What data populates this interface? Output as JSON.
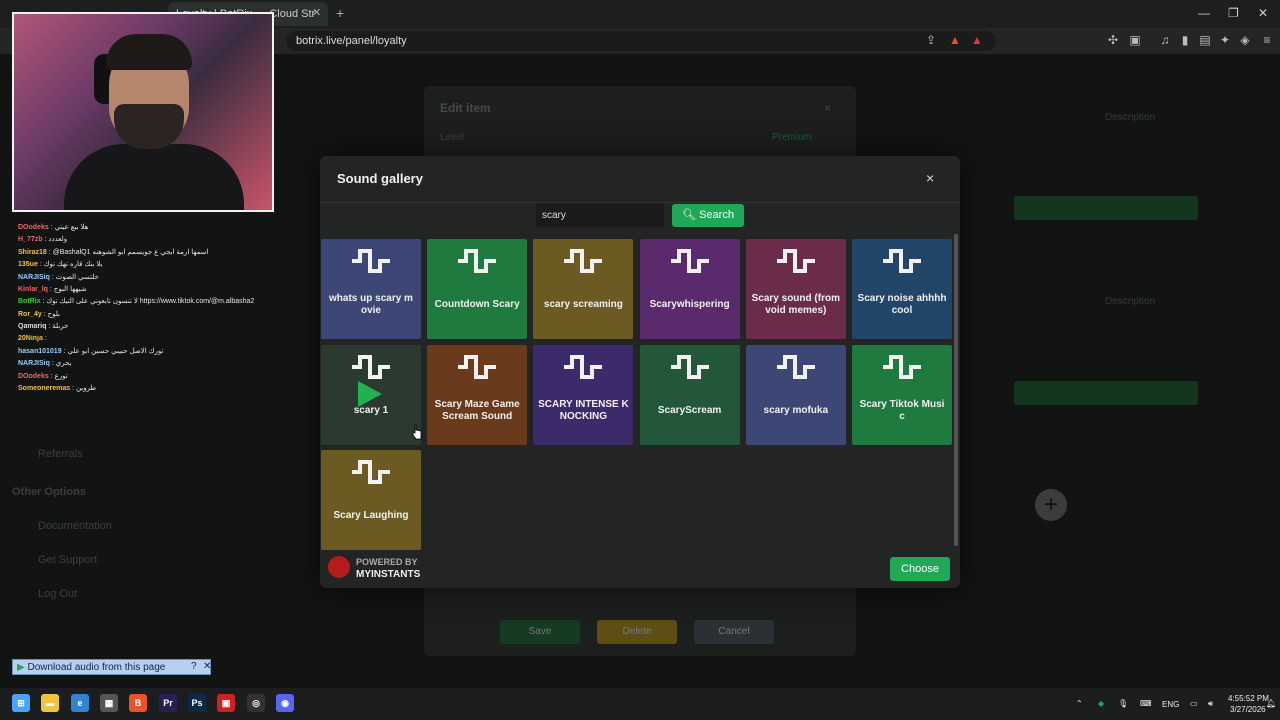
{
  "browser": {
    "tab_title": "Loyalty | BotRix — Cloud Str",
    "tab_close": "✕",
    "tab_new": "+",
    "url": "botrix.live/panel/loyalty",
    "win_minimize": "—",
    "win_restore": "❐",
    "win_close": "✕"
  },
  "background_page": {
    "edit_item_title": "Edit item",
    "level_label": "Level",
    "premium_label": "Premium",
    "description_label": "Description",
    "save_label": "Save",
    "delete_label": "Delete",
    "cancel_label": "Cancel",
    "menu_items": [
      "Referrals",
      "Other Options",
      "Documentation",
      "Get Support",
      "Log Out"
    ]
  },
  "chat": {
    "lines": [
      {
        "user": "DOodeks",
        "text": ": هلا بيع عيني",
        "color": "#e66"
      },
      {
        "user": "H_77zb",
        "text": ": ولعددد",
        "color": "#e66"
      },
      {
        "user": "Shiraz18",
        "text": ": @BashalQ1 اسمها ارمة ابجي ع جويسمم ابو الشوهنه",
        "color": "#f0c040"
      },
      {
        "user": "135ue",
        "text": ": يلا بنك قاره تهك توك",
        "color": "#f0c040"
      },
      {
        "user": "NARJISiq",
        "text": ": خلتسي الصوت",
        "color": "#9cf"
      },
      {
        "user": "Kinlar_lq",
        "text": ": شيهها البوج",
        "color": "#e66"
      },
      {
        "user": "BotRix",
        "text": ": لا تنسون تابعوني على التيك توك https://www.tiktok.com/@m.albasha2",
        "color": "#3c3"
      },
      {
        "user": "Ror_4y",
        "text": ": بلوح",
        "color": "#f0c040"
      },
      {
        "user": "Qamariq",
        "text": ": خربلة",
        "color": "#ddd"
      },
      {
        "user": "20Ninja",
        "text": ":",
        "color": "#f0c040"
      },
      {
        "user": "hasan101019",
        "text": ": تورك الاصل حبيبي حسين ابو علي",
        "color": "#9cf"
      },
      {
        "user": "NARJISiq",
        "text": ": بحري",
        "color": "#9cf"
      },
      {
        "user": "DOodeks",
        "text": ": تورع",
        "color": "#e66"
      },
      {
        "user": "Someoneremas",
        "text": ": طروين",
        "color": "#f0c040"
      }
    ]
  },
  "download_bar": {
    "label": "Download audio from this page"
  },
  "modal": {
    "title": "Sound gallery",
    "close": "×",
    "search": {
      "value": "scary",
      "button_label": "Search"
    },
    "sounds": [
      {
        "label": "whats up scary m ovie",
        "color": "#3d4776"
      },
      {
        "label": "Countdown Scary",
        "color": "#1e7a3e"
      },
      {
        "label": "scary screaming",
        "color": "#6b5a22"
      },
      {
        "label": "Scarywhispering",
        "color": "#5a2a6c"
      },
      {
        "label": "Scary sound (from void memes)",
        "color": "#6a2c4a"
      },
      {
        "label": "Scary noise ahhhh cool",
        "color": "#22466a"
      },
      {
        "label": "scary 1",
        "color": "#2a3a30",
        "playing": true
      },
      {
        "label": "Scary Maze Game Scream Sound",
        "color": "#6a3a1c"
      },
      {
        "label": "SCARY INTENSE K NOCKING",
        "color": "#3c2a6a"
      },
      {
        "label": "ScaryScream",
        "color": "#23573a"
      },
      {
        "label": "scary mofuka",
        "color": "#3d4776"
      },
      {
        "label": "Scary Tiktok Musi c",
        "color": "#1e7a3e"
      },
      {
        "label": "Scary Laughing",
        "color": "#6b5a22"
      }
    ],
    "footer": {
      "powered_by": "POWERED BY",
      "brand": "MYINSTANTS",
      "choose_label": "Choose"
    }
  },
  "taskbar": {
    "language": "ENG",
    "time": "4:55:52 PM",
    "date": "3/27/2026",
    "apps": [
      {
        "name": "windows-start",
        "glyph": "⊞",
        "color": "#4aa3ff"
      },
      {
        "name": "file-explorer",
        "glyph": "▬",
        "color": "#f3c33c"
      },
      {
        "name": "edge",
        "glyph": "e",
        "color": "#2f86d0"
      },
      {
        "name": "store",
        "glyph": "▦",
        "color": "#555"
      },
      {
        "name": "brave",
        "glyph": "B",
        "color": "#e8542a"
      },
      {
        "name": "premiere",
        "glyph": "Pr",
        "color": "#2a1f55"
      },
      {
        "name": "photoshop",
        "glyph": "Ps",
        "color": "#0b2a4a"
      },
      {
        "name": "app-red",
        "glyph": "▣",
        "color": "#c22"
      },
      {
        "name": "obs",
        "glyph": "◎",
        "color": "#333"
      },
      {
        "name": "discord",
        "glyph": "◉",
        "color": "#5865f2"
      }
    ]
  }
}
